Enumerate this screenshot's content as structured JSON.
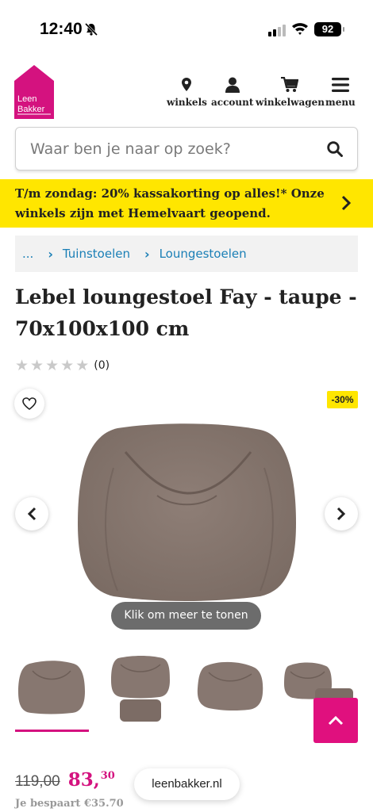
{
  "status_bar": {
    "time": "12:40",
    "battery": "92"
  },
  "brand": {
    "logo_line1": "Leen",
    "logo_line2": "Bakker",
    "color": "#d4127f"
  },
  "nav": {
    "stores": "winkels",
    "account": "account",
    "cart": "winkelwagen",
    "menu": "menu"
  },
  "search": {
    "placeholder": "Waar ben je naar op zoek?"
  },
  "promo": {
    "text": "T/m zondag: 20% kassakorting op alles!* Onze winkels zijn met Hemelvaart geopend.",
    "background": "#ffe600"
  },
  "breadcrumb": {
    "items": [
      "...",
      "Tuinstoelen",
      "Loungestoelen"
    ]
  },
  "product": {
    "title": "Lebel loungestoel Fay - taupe - 70x100x100 cm",
    "rating_count": "(0)",
    "rating_stars": 0,
    "discount_badge": "-30%",
    "more_button": "Klik om meer te tonen",
    "old_price": "119,00",
    "new_price": "83,",
    "new_price_cents": "30",
    "savings": "Je bespaart €35.70",
    "image_color": "#8a7a72"
  },
  "browser": {
    "url": "leenbakker.nl"
  }
}
